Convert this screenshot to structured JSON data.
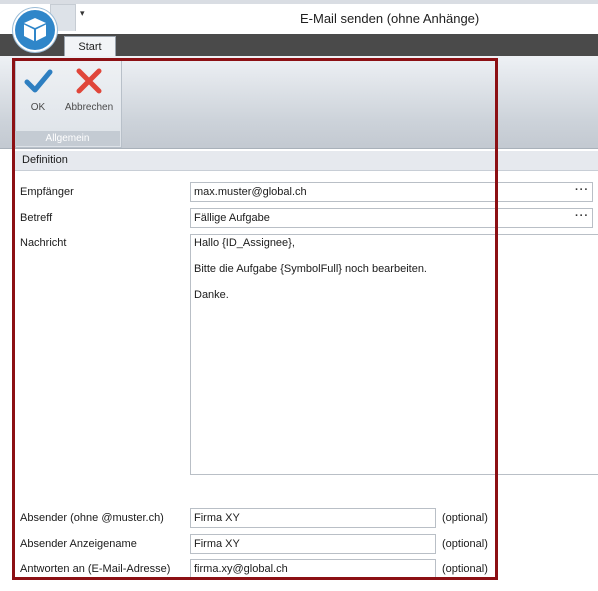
{
  "window": {
    "title": "E-Mail senden (ohne Anhänge)"
  },
  "qat": {
    "dropdown_glyph": "▾"
  },
  "ribbon": {
    "tabs": [
      {
        "label": "Start"
      }
    ],
    "group": {
      "label": "Allgemein",
      "buttons": [
        {
          "label": "OK",
          "icon": "checkmark-icon",
          "color": "#2e7fc1"
        },
        {
          "label": "Abbrechen",
          "icon": "cross-icon",
          "color": "#e0463a"
        }
      ]
    }
  },
  "section": {
    "title": "Definition"
  },
  "form": {
    "recipient": {
      "label": "Empfänger",
      "value": "max.muster@global.ch",
      "more": "···"
    },
    "subject": {
      "label": "Betreff",
      "value": "Fällige Aufgabe",
      "more": "···"
    },
    "message": {
      "label": "Nachricht",
      "lines": [
        "Hallo {ID_Assignee},",
        "Bitte die Aufgabe {SymbolFull} noch bearbeiten.",
        "Danke."
      ]
    },
    "sender": {
      "label": "Absender (ohne @muster.ch)",
      "value": "Firma XY",
      "hint": "(optional)"
    },
    "sender_display": {
      "label": "Absender Anzeigename",
      "value": "Firma XY",
      "hint": "(optional)"
    },
    "reply_to": {
      "label": "Antworten an (E-Mail-Adresse)",
      "value": "firma.xy@global.ch",
      "hint": "(optional)"
    }
  }
}
